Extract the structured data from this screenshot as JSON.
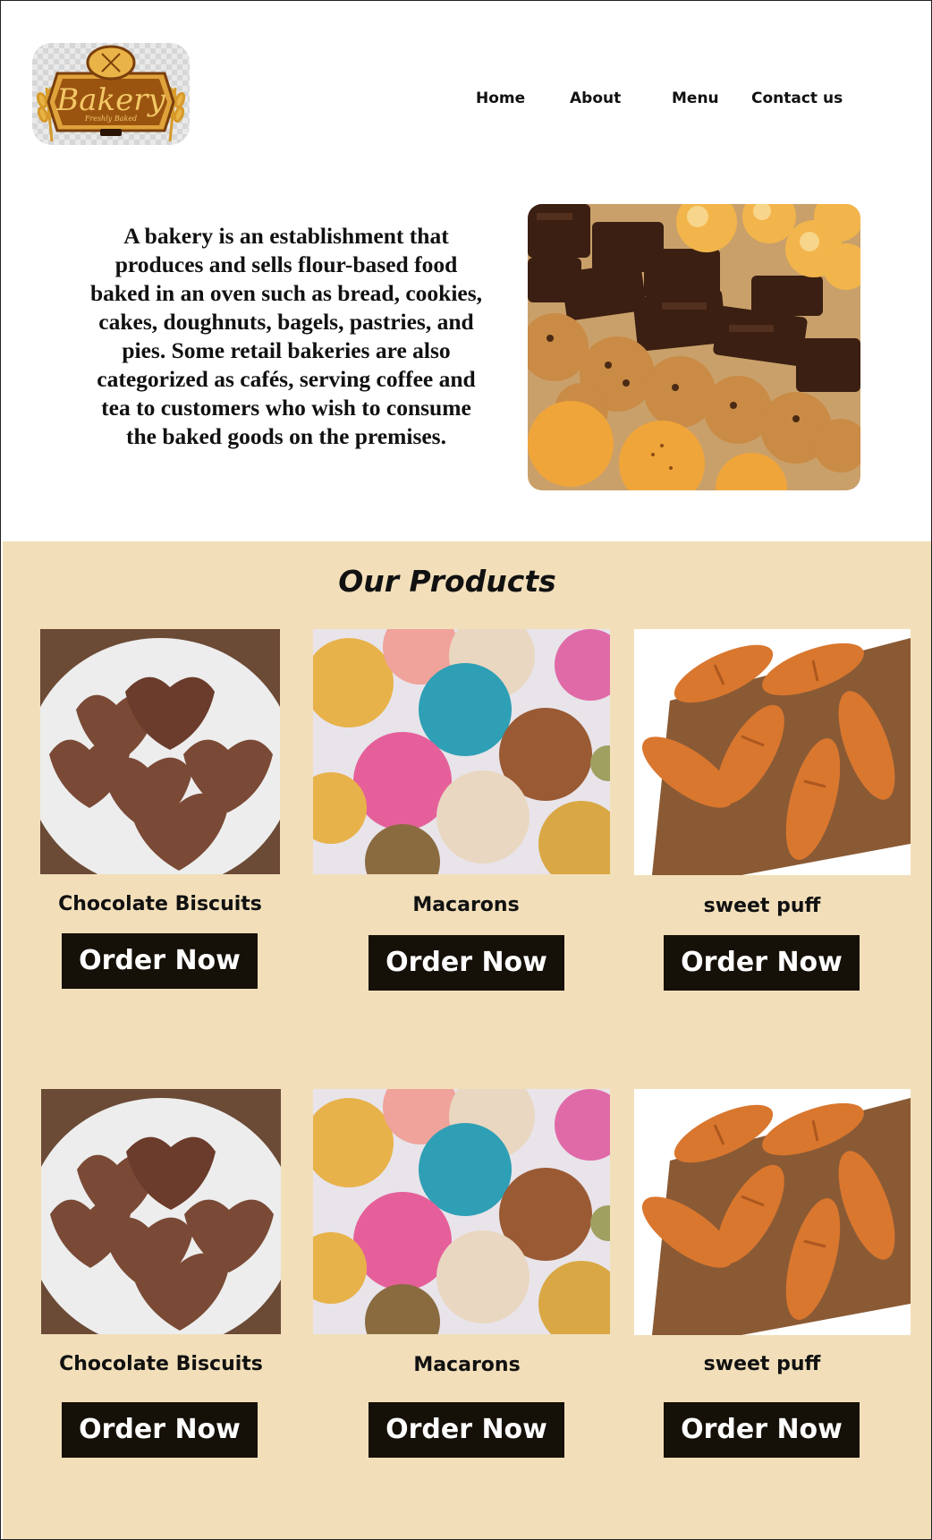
{
  "header": {
    "logo": {
      "brand": "Bakery",
      "tagline": "Freshly Baked"
    },
    "nav": [
      {
        "label": "Home"
      },
      {
        "label": "About"
      },
      {
        "label": "Menu"
      },
      {
        "label": "Contact us"
      }
    ]
  },
  "intro": {
    "text": "A bakery is an establishment that produces and sells flour-based food baked in an oven such as bread, cookies, cakes, doughnuts, bagels, pastries, and pies. Some retail bakeries are also categorized as cafés, serving coffee and tea to customers who wish to consume the baked goods on the premises.",
    "image": "assorted-baked-goods-photo"
  },
  "products": {
    "title": "Our Products",
    "rows": [
      [
        {
          "name": "Chocolate Biscuits",
          "button": "Order Now",
          "image": "heart-chocolate-biscuits-photo"
        },
        {
          "name": "Macarons",
          "button": "Order Now",
          "image": "macarons-photo"
        },
        {
          "name": "sweet puff",
          "button": "Order Now",
          "image": "croissants-photo"
        }
      ],
      [
        {
          "name": "Chocolate Biscuits",
          "button": "Order Now",
          "image": "heart-chocolate-biscuits-photo"
        },
        {
          "name": "Macarons",
          "button": "Order Now",
          "image": "macarons-photo"
        },
        {
          "name": "sweet puff",
          "button": "Order Now",
          "image": "croissants-photo"
        }
      ]
    ]
  },
  "colors": {
    "products_background": "#f2dfba",
    "button_background": "#151008",
    "button_text": "#ffffff",
    "logo_gold": "#c98a1a",
    "logo_brown": "#7a3f0c"
  }
}
